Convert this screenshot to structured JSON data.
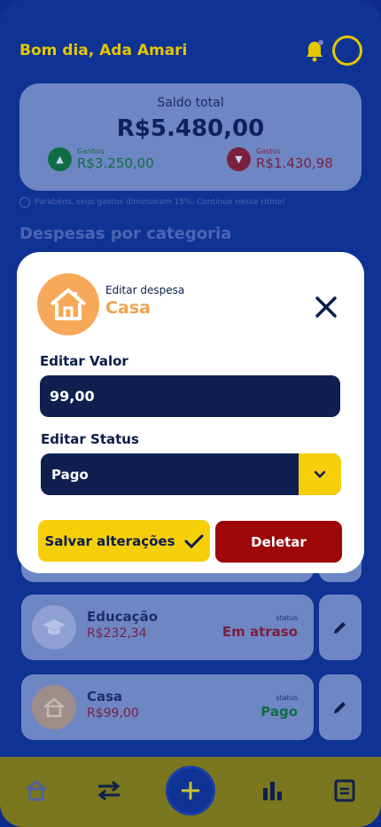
{
  "header": {
    "greeting": "Bom dia, Ada Amari"
  },
  "balance": {
    "label": "Saldo total",
    "value": "R$5.480,00",
    "gains_label": "Ganhos",
    "gains_value": "R$3.250,00",
    "expenses_label": "Gastos",
    "expenses_value": "R$1.430,98"
  },
  "tip": "Parabéns, seus gastos diminuíram 15%. Continue nesse ritmo!",
  "section_title": "Despesas por categoria",
  "categories": [
    {
      "name": "Educação",
      "amount": "R$232,34",
      "status_label": "status",
      "status": "Em atraso",
      "status_color": "#7a1f3e",
      "icon": "graduation-cap-icon",
      "icon_bg": "#8ea0d4"
    },
    {
      "name": "Casa",
      "amount": "R$99,00",
      "status_label": "status",
      "status": "Pago",
      "status_color": "#0f6d46",
      "icon": "house-icon",
      "icon_bg": "#9f8d8b"
    }
  ],
  "modal": {
    "subtitle": "Editar despesa",
    "title": "Casa",
    "value_label": "Editar Valor",
    "value": "99,00",
    "status_label": "Editar Status",
    "status_value": "Pago",
    "save_label": "Salvar alterações",
    "delete_label": "Deletar"
  },
  "nav": {
    "items": [
      "home-icon",
      "transfer-icon",
      "add-icon",
      "bar-chart-icon",
      "document-icon"
    ]
  },
  "colors": {
    "primary": "#0f1f50",
    "accent": "#f5cf0a",
    "danger": "#9d0707",
    "category_house": "#f7a858"
  }
}
